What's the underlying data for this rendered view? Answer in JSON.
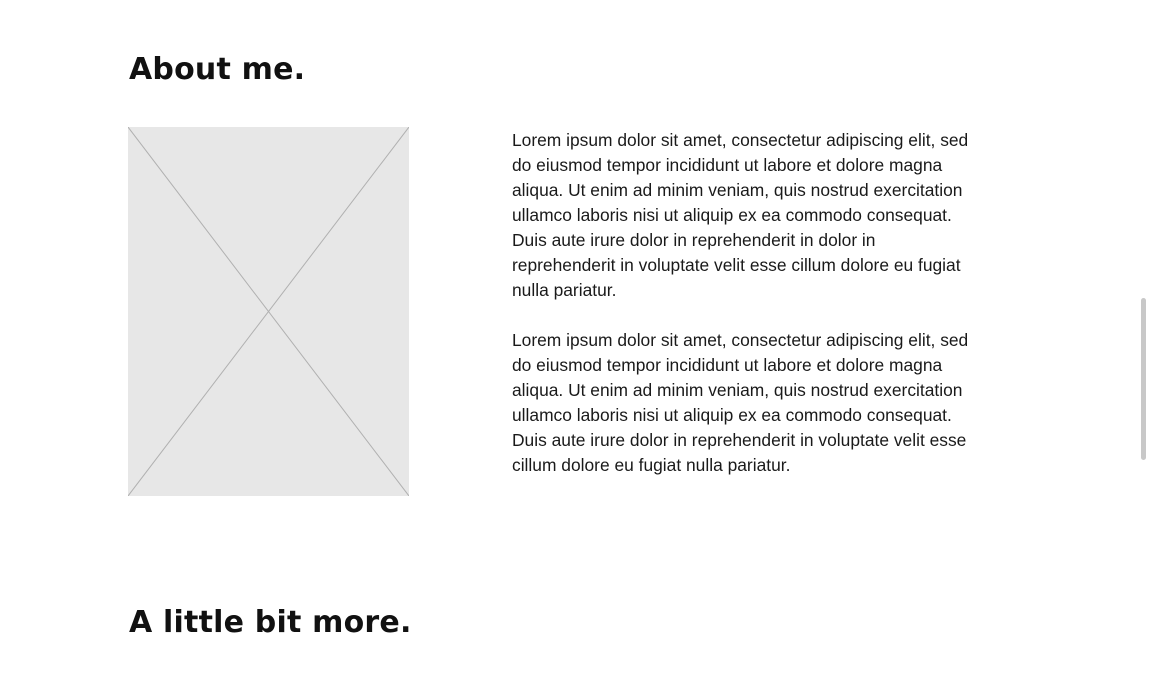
{
  "about": {
    "title": "About me.",
    "image": {
      "icon": "image-placeholder-icon",
      "fill": "#e7e7e7",
      "stroke": "#b0b0b0"
    },
    "paragraphs": [
      "Lorem ipsum dolor sit amet, consectetur adipiscing elit, sed do eiusmod tempor incididunt ut labore et dolore magna aliqua. Ut enim ad minim veniam, quis nostrud exercitation ullamco laboris nisi ut aliquip ex ea commodo consequat. Duis aute irure dolor in reprehenderit in dolor in reprehenderit in voluptate velit esse cillum dolore eu fugiat nulla pariatur.",
      "Lorem ipsum dolor sit amet, consectetur adipiscing elit, sed do eiusmod tempor incididunt ut labore et dolore magna aliqua. Ut enim ad minim veniam, quis nostrud exercitation ullamco laboris nisi ut aliquip ex ea commodo consequat. Duis aute irure dolor in reprehenderit in voluptate velit esse cillum dolore eu fugiat nulla pariatur."
    ]
  },
  "more": {
    "title": "A little bit more."
  },
  "colors": {
    "background": "#ffffff",
    "text": "#1a1a1a",
    "scrollbar": "#c8c8c8"
  }
}
